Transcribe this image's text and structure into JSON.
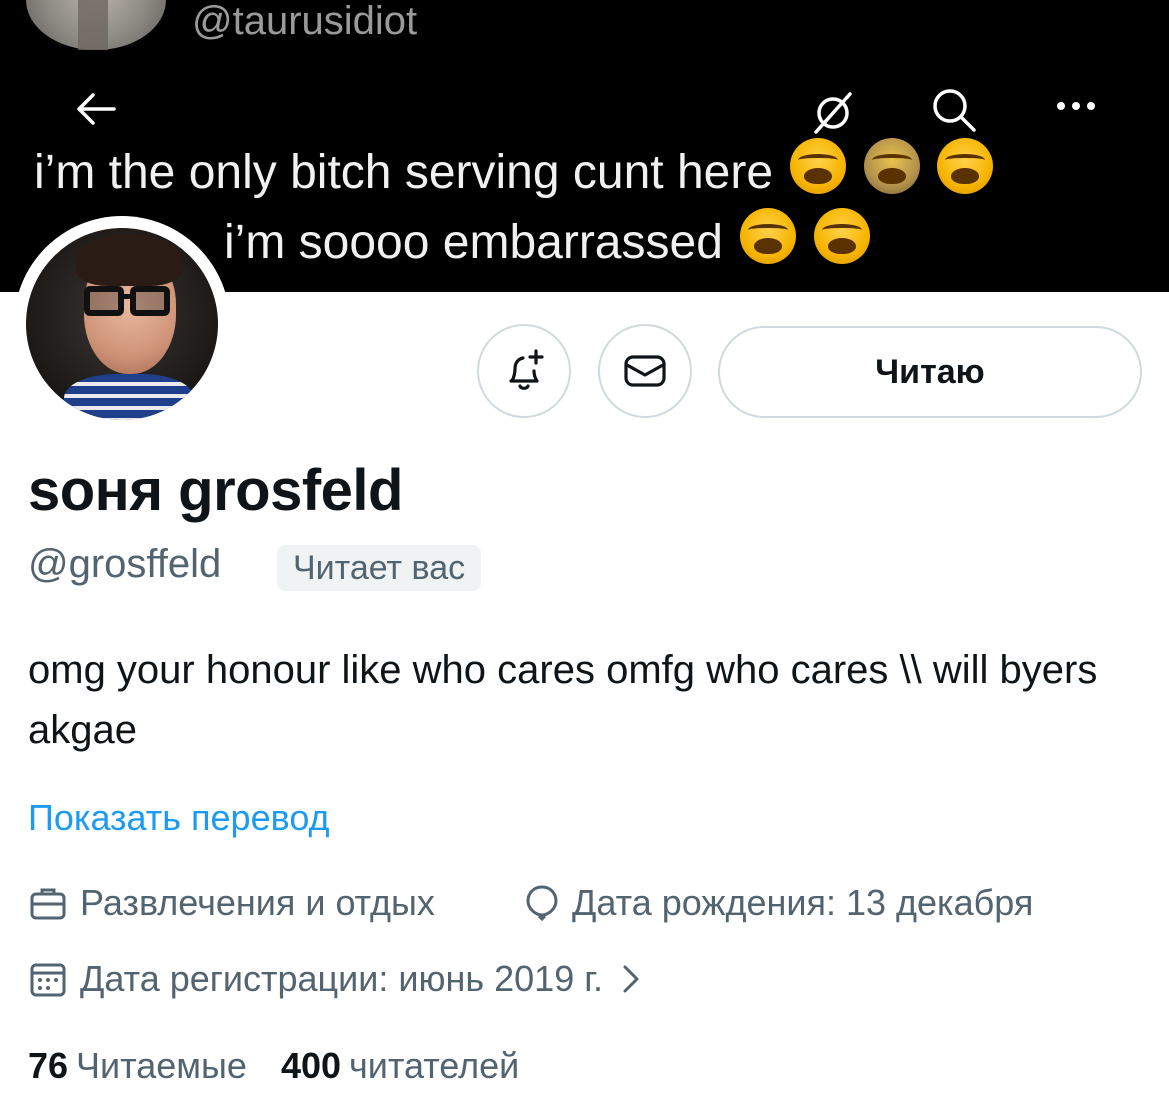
{
  "banner": {
    "handle": "@taurusidiot",
    "line1": "i’m the only bitch serving cunt here",
    "line2": "i’m soooo embarrassed"
  },
  "nav": {
    "back_icon": "arrow-left-icon",
    "grok_icon": "slashed-circle-icon",
    "search_icon": "search-icon",
    "more_icon": "more-horizontal-icon"
  },
  "actions": {
    "notify_icon": "bell-plus-icon",
    "dm_icon": "envelope-icon",
    "follow_label": "Читаю"
  },
  "profile": {
    "name": "soня grosfeld",
    "handle": "@grosffeld",
    "follows_you": "Читает вас",
    "bio": "omg your honour like who cares omfg who cares \\\\ will byers akgae",
    "translate": "Показать перевод"
  },
  "meta": {
    "category": "Развлечения и отдых",
    "birthday": "Дата рождения: 13 декабря",
    "joined": "Дата регистрации: июнь 2019 г."
  },
  "stats": {
    "following_count": "76",
    "following_label": "Читаемые",
    "followers_count": "400",
    "followers_label": "читателей"
  },
  "colors": {
    "accent": "#1d9bf0",
    "secondary_text": "#536471",
    "border": "#cfd9de",
    "banner_bg": "#000000"
  }
}
